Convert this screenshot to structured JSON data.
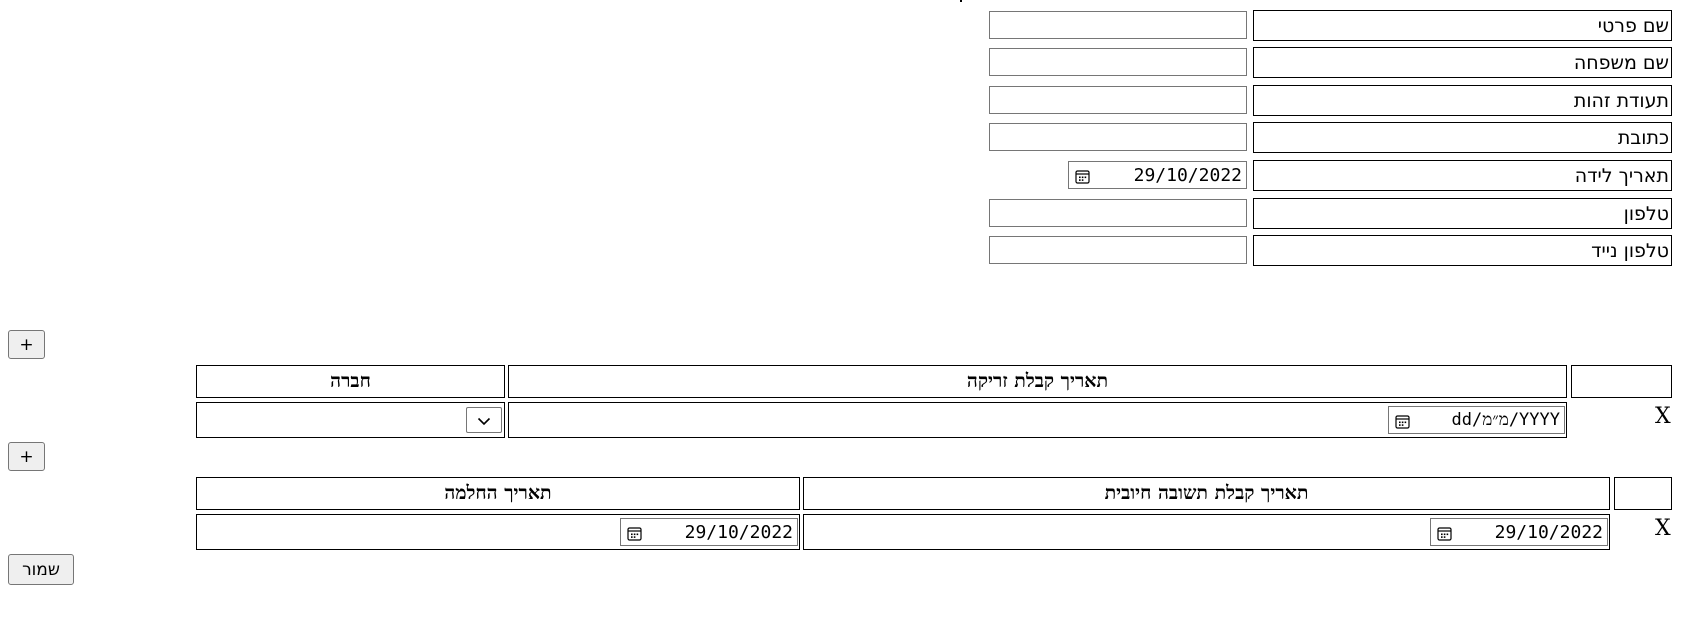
{
  "personal": {
    "first_name_label": "שם פרטי",
    "last_name_label": "שם משפחה",
    "id_label": "תעודת זהות",
    "address_label": "כתובת",
    "birthdate_label": "תאריך לידה",
    "birthdate_value": "29/10/2022",
    "phone_label": "טלפון",
    "mobile_label": "טלפון נייד"
  },
  "vaccines": {
    "add_label": "+",
    "col_date": "תאריך קבלת זריקה",
    "col_company": "חברה",
    "row_delete": "X",
    "row_date_placeholder": "dd/מ״מ/YYYY"
  },
  "illness": {
    "add_label": "+",
    "col_positive_date": "תאריך קבלת תשובה חיובית",
    "col_recovery_date": "תאריך החלמה",
    "row_delete": "X",
    "positive_date_value": "29/10/2022",
    "recovery_date_value": "29/10/2022"
  },
  "save_label": "שמור"
}
